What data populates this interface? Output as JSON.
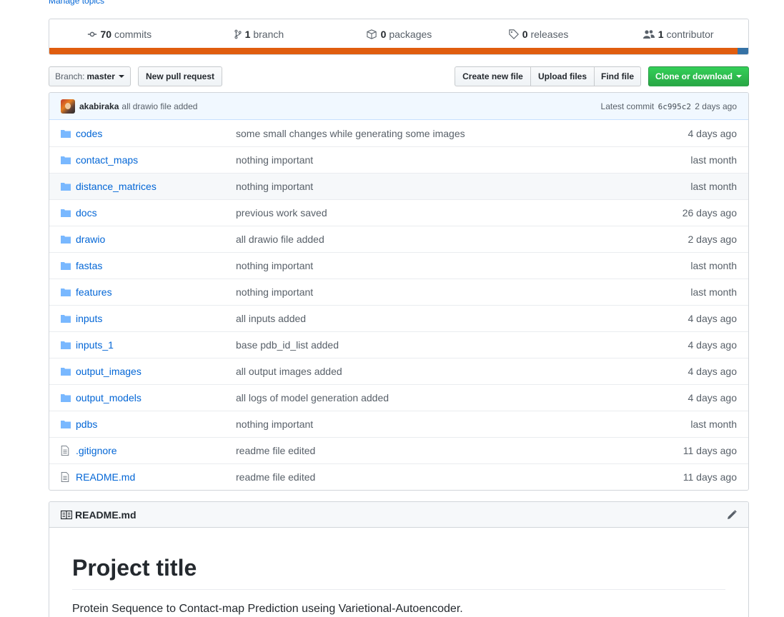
{
  "manage_topics": "Manage topics",
  "summary": {
    "commits": {
      "count": "70",
      "label": "commits"
    },
    "branches": {
      "count": "1",
      "label": "branch"
    },
    "packages": {
      "count": "0",
      "label": "packages"
    },
    "releases": {
      "count": "0",
      "label": "releases"
    },
    "contributors": {
      "count": "1",
      "label": "contributor"
    }
  },
  "language_bar": [
    {
      "color": "#e05d0f",
      "fraction": 0.985
    },
    {
      "color": "#3572a5",
      "fraction": 0.015
    }
  ],
  "file_nav": {
    "branch_prefix": "Branch:",
    "branch_name": "master",
    "new_pull_request": "New pull request",
    "create_new_file": "Create new file",
    "upload_files": "Upload files",
    "find_file": "Find file",
    "clone_or_download": "Clone or download"
  },
  "commit_tease": {
    "author": "akabiraka",
    "message": "all drawio file added",
    "latest_commit_label": "Latest commit",
    "sha": "6c995c2",
    "age": "2 days ago"
  },
  "files": [
    {
      "type": "dir",
      "name": "codes",
      "message": "some small changes while generating some images",
      "age": "4 days ago"
    },
    {
      "type": "dir",
      "name": "contact_maps",
      "message": "nothing important",
      "age": "last month"
    },
    {
      "type": "dir",
      "name": "distance_matrices",
      "message": "nothing important",
      "age": "last month"
    },
    {
      "type": "dir",
      "name": "docs",
      "message": "previous work saved",
      "age": "26 days ago"
    },
    {
      "type": "dir",
      "name": "drawio",
      "message": "all drawio file added",
      "age": "2 days ago"
    },
    {
      "type": "dir",
      "name": "fastas",
      "message": "nothing important",
      "age": "last month"
    },
    {
      "type": "dir",
      "name": "features",
      "message": "nothing important",
      "age": "last month"
    },
    {
      "type": "dir",
      "name": "inputs",
      "message": "all inputs added",
      "age": "4 days ago"
    },
    {
      "type": "dir",
      "name": "inputs_1",
      "message": "base pdb_id_list added",
      "age": "4 days ago"
    },
    {
      "type": "dir",
      "name": "output_images",
      "message": "all output images added",
      "age": "4 days ago"
    },
    {
      "type": "dir",
      "name": "output_models",
      "message": "all logs of model generation added",
      "age": "4 days ago"
    },
    {
      "type": "dir",
      "name": "pdbs",
      "message": "nothing important",
      "age": "last month"
    },
    {
      "type": "file",
      "name": ".gitignore",
      "message": "readme file edited",
      "age": "11 days ago"
    },
    {
      "type": "file",
      "name": "README.md",
      "message": "readme file edited",
      "age": "11 days ago"
    }
  ],
  "readme": {
    "filename": "README.md",
    "title": "Project title",
    "paragraph": "Protein Sequence to Contact-map Prediction useing Varietional-Autoencoder."
  }
}
